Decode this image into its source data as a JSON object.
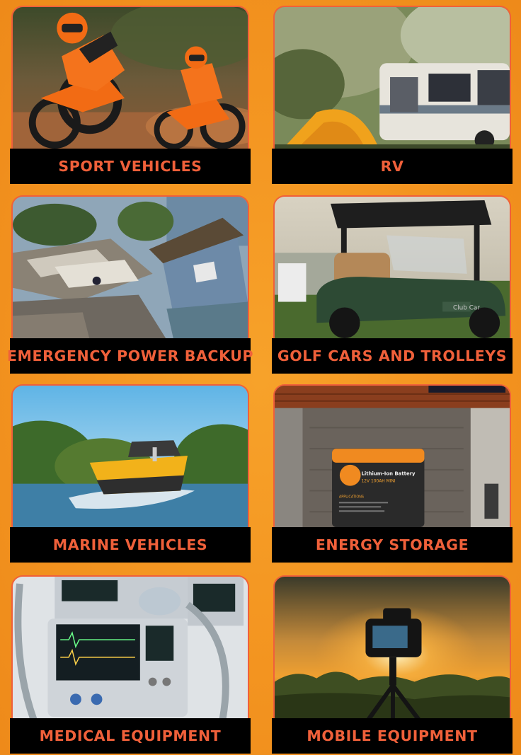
{
  "cards": [
    {
      "label": "SPORT VEHICLES",
      "image": "motocross-riders-photo"
    },
    {
      "label": "RV",
      "image": "rv-camping-photo"
    },
    {
      "label": "EMERGENCY POWER BACKUP",
      "image": "storm-damage-photo"
    },
    {
      "label": "GOLF CARS AND TROLLEYS",
      "image": "golf-cart-photo"
    },
    {
      "label": "MARINE VEHICLES",
      "image": "speedboat-photo"
    },
    {
      "label": "ENERGY STORAGE",
      "image": "garage-battery-photo"
    },
    {
      "label": "MEDICAL EQUIPMENT",
      "image": "medical-ventilator-photo"
    },
    {
      "label": "MOBILE EQUIPMENT",
      "image": "camera-tripod-sunset-photo"
    }
  ],
  "battery": {
    "title": "Lithium-Ion Battery",
    "subtitle": "12V 100AH MINI",
    "section": "APPLICATIONS"
  },
  "golf_cart": {
    "badge": "Club Car"
  },
  "colors": {
    "accent": "#f0603a",
    "background": "#f39420",
    "label_bg": "#000000"
  }
}
